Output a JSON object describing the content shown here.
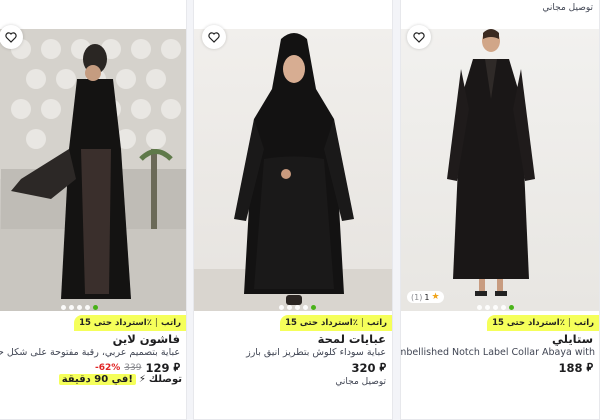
{
  "top_delivery": "توصيل مجاني",
  "cashback": {
    "text": "استرداد حتى 15٪",
    "brand": "راتب"
  },
  "products": [
    {
      "name": "فاشون لاين",
      "description": "عباية بتصميم عربي، رقبة مفتوحة على شكل حرف",
      "price": "129",
      "old_price": "339",
      "discount": "-62%",
      "express_prefix": "توصلك",
      "express_highlight": "في 90 دقيقة!"
    },
    {
      "name": "عبايات لمحة",
      "description": "عباية سوداء كلوش بتطريز انيق بارز",
      "price": "320",
      "delivery": "توصيل مجاني"
    },
    {
      "name": "ستايلي",
      "description": "Embellished Notch Label Collar Abaya with",
      "price": "188",
      "rating": "1",
      "rating_count": "(1)"
    }
  ],
  "icons": {
    "wishlist": "heart-outline-icon",
    "currency": "riyal-icon",
    "express": "lightning-bolt-icon",
    "star": "star-icon"
  },
  "colors": {
    "cashback_bg": "#f5ff5a",
    "active_dot": "#38ae04",
    "discount": "#e02424"
  }
}
